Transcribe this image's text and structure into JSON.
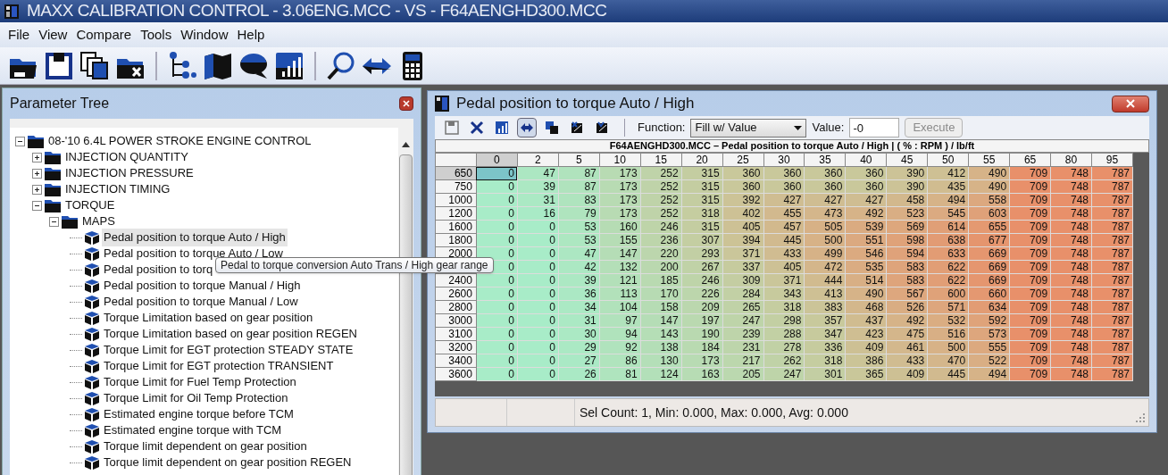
{
  "window": {
    "title": "MAXX CALIBRATION CONTROL - 3.06ENG.MCC - VS - F64AENGHD300.MCC"
  },
  "menu": [
    "File",
    "View",
    "Compare",
    "Tools",
    "Window",
    "Help"
  ],
  "parameter_tree": {
    "title": "Parameter Tree",
    "items": [
      {
        "label": "08-'10 6.4L POWER STROKE ENGINE CONTROL",
        "kind": "folder",
        "expanded": true,
        "children": [
          {
            "label": "INJECTION QUANTITY",
            "kind": "folder",
            "expanded": false
          },
          {
            "label": "INJECTION PRESSURE",
            "kind": "folder",
            "expanded": false
          },
          {
            "label": "INJECTION TIMING",
            "kind": "folder",
            "expanded": false
          },
          {
            "label": "TORQUE",
            "kind": "folder",
            "expanded": true,
            "children": [
              {
                "label": "MAPS",
                "kind": "folder",
                "expanded": true,
                "children": [
                  {
                    "label": "Pedal position to torque Auto / High",
                    "kind": "map",
                    "selected": true
                  },
                  {
                    "label": "Pedal position to torque Auto / Low",
                    "kind": "map",
                    "selected": false
                  },
                  {
                    "label": "Pedal position to torq",
                    "kind": "map",
                    "selected": false
                  },
                  {
                    "label": "Pedal position to torque Manual / High",
                    "kind": "map",
                    "selected": false
                  },
                  {
                    "label": "Pedal position to torque Manual / Low",
                    "kind": "map",
                    "selected": false
                  },
                  {
                    "label": "Torque Limitation based on gear position",
                    "kind": "map",
                    "selected": false
                  },
                  {
                    "label": "Torque Limitation based on gear position REGEN",
                    "kind": "map",
                    "selected": false
                  },
                  {
                    "label": "Torque Limit for EGT protection STEADY STATE",
                    "kind": "map",
                    "selected": false
                  },
                  {
                    "label": "Torque Limit for EGT protection TRANSIENT",
                    "kind": "map",
                    "selected": false
                  },
                  {
                    "label": "Torque Limit for Fuel Temp Protection",
                    "kind": "map",
                    "selected": false
                  },
                  {
                    "label": "Torque Limit for Oil Temp Protection",
                    "kind": "map",
                    "selected": false
                  },
                  {
                    "label": "Estimated engine torque before TCM",
                    "kind": "map",
                    "selected": false
                  },
                  {
                    "label": "Estimated engine torque with TCM",
                    "kind": "map",
                    "selected": false
                  },
                  {
                    "label": "Torque limit dependent on gear position",
                    "kind": "map",
                    "selected": false
                  },
                  {
                    "label": "Torque limit dependent on gear position REGEN",
                    "kind": "map",
                    "selected": false
                  }
                ]
              }
            ]
          }
        ]
      }
    ]
  },
  "tooltip": "Pedal to torque conversion Auto Trans / High gear range",
  "map_window": {
    "title": "Pedal position to torque Auto / High",
    "function_label": "Function:",
    "function_value": "Fill w/ Value",
    "value_label": "Value:",
    "value": "-0",
    "execute_button": "Execute",
    "table": {
      "caption": "F64AENGHD300.MCC – Pedal position to torque Auto / High |  ( % : RPM ) / lb/ft",
      "columns": [
        {
          "label": "0",
          "selected": true
        },
        {
          "label": "2",
          "selected": false
        },
        {
          "label": "5",
          "selected": false
        },
        {
          "label": "10",
          "selected": false
        },
        {
          "label": "15",
          "selected": false
        },
        {
          "label": "20",
          "selected": false
        },
        {
          "label": "25",
          "selected": false
        },
        {
          "label": "30",
          "selected": false
        },
        {
          "label": "35",
          "selected": false
        },
        {
          "label": "40",
          "selected": false
        },
        {
          "label": "45",
          "selected": false
        },
        {
          "label": "50",
          "selected": false
        },
        {
          "label": "55",
          "selected": false
        },
        {
          "label": "65",
          "selected": false
        },
        {
          "label": "80",
          "selected": false
        },
        {
          "label": "95",
          "selected": false
        }
      ],
      "rows": [
        {
          "rpm": "650",
          "selected": true,
          "cells": [
            "0",
            "47",
            "87",
            "173",
            "252",
            "315",
            "360",
            "360",
            "360",
            "360",
            "390",
            "412",
            "490",
            "709",
            "748",
            "787"
          ]
        },
        {
          "rpm": "750",
          "selected": false,
          "cells": [
            "0",
            "39",
            "87",
            "173",
            "252",
            "315",
            "360",
            "360",
            "360",
            "360",
            "390",
            "435",
            "490",
            "709",
            "748",
            "787"
          ]
        },
        {
          "rpm": "1000",
          "selected": false,
          "cells": [
            "0",
            "31",
            "83",
            "173",
            "252",
            "315",
            "392",
            "427",
            "427",
            "427",
            "458",
            "494",
            "558",
            "709",
            "748",
            "787"
          ]
        },
        {
          "rpm": "1200",
          "selected": false,
          "cells": [
            "0",
            "16",
            "79",
            "173",
            "252",
            "318",
            "402",
            "455",
            "473",
            "492",
            "523",
            "545",
            "603",
            "709",
            "748",
            "787"
          ]
        },
        {
          "rpm": "1600",
          "selected": false,
          "cells": [
            "0",
            "0",
            "53",
            "160",
            "246",
            "315",
            "405",
            "457",
            "505",
            "539",
            "569",
            "614",
            "655",
            "709",
            "748",
            "787"
          ]
        },
        {
          "rpm": "1800",
          "selected": false,
          "cells": [
            "0",
            "0",
            "53",
            "155",
            "236",
            "307",
            "394",
            "445",
            "500",
            "551",
            "598",
            "638",
            "677",
            "709",
            "748",
            "787"
          ]
        },
        {
          "rpm": "2000",
          "selected": false,
          "cells": [
            "0",
            "0",
            "47",
            "147",
            "220",
            "293",
            "371",
            "433",
            "499",
            "546",
            "594",
            "633",
            "669",
            "709",
            "748",
            "787"
          ]
        },
        {
          "cells": [
            "0",
            "0",
            "42",
            "132",
            "200",
            "267",
            "337",
            "405",
            "472",
            "535",
            "583",
            "622",
            "669",
            "709",
            "748",
            "787"
          ]
        },
        {
          "rpm": "2400",
          "selected": false,
          "cells": [
            "0",
            "0",
            "39",
            "121",
            "185",
            "246",
            "309",
            "371",
            "444",
            "514",
            "583",
            "622",
            "669",
            "709",
            "748",
            "787"
          ]
        },
        {
          "rpm": "2600",
          "selected": false,
          "cells": [
            "0",
            "0",
            "36",
            "113",
            "170",
            "226",
            "284",
            "343",
            "413",
            "490",
            "567",
            "600",
            "660",
            "709",
            "748",
            "787"
          ]
        },
        {
          "rpm": "2800",
          "selected": false,
          "cells": [
            "0",
            "0",
            "34",
            "104",
            "158",
            "209",
            "265",
            "318",
            "383",
            "468",
            "526",
            "571",
            "634",
            "709",
            "748",
            "787"
          ]
        },
        {
          "rpm": "3000",
          "selected": false,
          "cells": [
            "0",
            "0",
            "31",
            "97",
            "147",
            "197",
            "247",
            "298",
            "357",
            "437",
            "492",
            "532",
            "592",
            "709",
            "748",
            "787"
          ]
        },
        {
          "rpm": "3100",
          "selected": false,
          "cells": [
            "0",
            "0",
            "30",
            "94",
            "143",
            "190",
            "239",
            "288",
            "347",
            "423",
            "475",
            "516",
            "573",
            "709",
            "748",
            "787"
          ]
        },
        {
          "rpm": "3200",
          "selected": false,
          "cells": [
            "0",
            "0",
            "29",
            "92",
            "138",
            "184",
            "231",
            "278",
            "336",
            "409",
            "461",
            "500",
            "555",
            "709",
            "748",
            "787"
          ]
        },
        {
          "rpm": "3400",
          "selected": false,
          "cells": [
            "0",
            "0",
            "27",
            "86",
            "130",
            "173",
            "217",
            "262",
            "318",
            "386",
            "433",
            "470",
            "522",
            "709",
            "748",
            "787"
          ]
        },
        {
          "rpm": "3600",
          "selected": false,
          "cells": [
            "0",
            "0",
            "26",
            "81",
            "124",
            "163",
            "205",
            "247",
            "301",
            "365",
            "409",
            "445",
            "494",
            "709",
            "748",
            "787"
          ]
        }
      ]
    },
    "status": "Sel Count: 1, Min: 0.000, Max: 0.000, Avg: 0.000"
  }
}
